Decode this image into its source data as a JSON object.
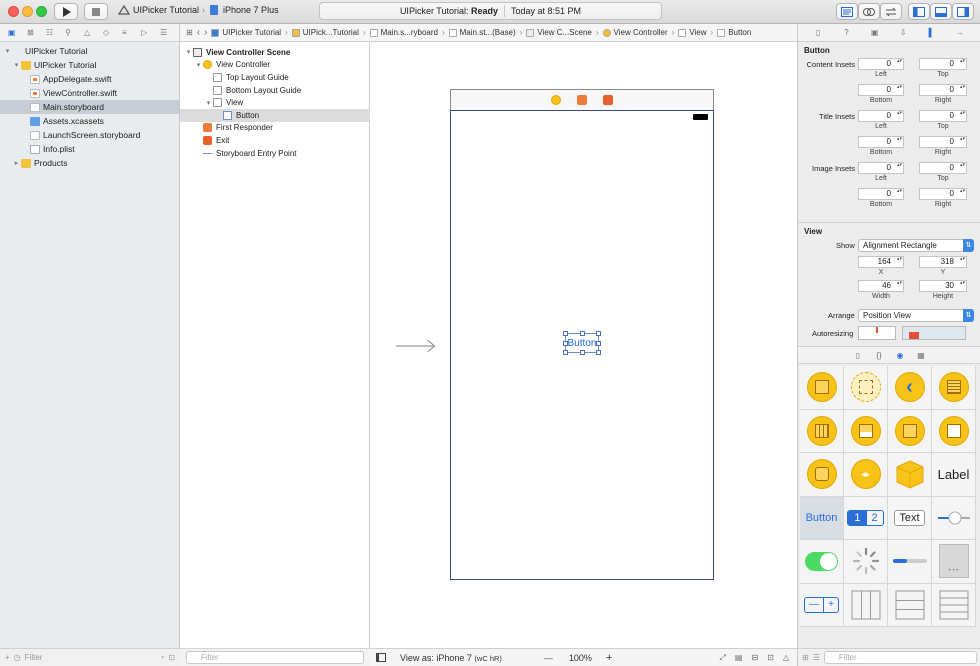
{
  "toolbar": {
    "scheme_project": "UIPicker Tutorial",
    "scheme_device": "iPhone 7 Plus",
    "activity_project": "UIPicker Tutorial:",
    "activity_status": "Ready",
    "activity_time": "Today at 8:51 PM"
  },
  "navigator": {
    "items": [
      {
        "label": "UIPicker Tutorial",
        "type": "project",
        "indent": 0,
        "disclosure": "▾"
      },
      {
        "label": "UIPicker Tutorial",
        "type": "folder",
        "indent": 1,
        "disclosure": "▾"
      },
      {
        "label": "AppDelegate.swift",
        "type": "swift",
        "indent": 2,
        "disclosure": ""
      },
      {
        "label": "ViewController.swift",
        "type": "swift",
        "indent": 2,
        "disclosure": ""
      },
      {
        "label": "Main.storyboard",
        "type": "sb",
        "indent": 2,
        "disclosure": "",
        "selected": true
      },
      {
        "label": "Assets.xcassets",
        "type": "xca",
        "indent": 2,
        "disclosure": ""
      },
      {
        "label": "LaunchScreen.storyboard",
        "type": "sb",
        "indent": 2,
        "disclosure": ""
      },
      {
        "label": "Info.plist",
        "type": "plist",
        "indent": 2,
        "disclosure": ""
      },
      {
        "label": "Products",
        "type": "folder",
        "indent": 1,
        "disclosure": "▸"
      }
    ],
    "filter_placeholder": "Filter"
  },
  "jumpbar": {
    "crumbs": [
      "UIPicker Tutorial",
      "UIPick...Tutorial",
      "Main.s...ryboard",
      "Main.st...(Base)",
      "View C...Scene",
      "View Controller",
      "View",
      "Button"
    ]
  },
  "outline": {
    "items": [
      {
        "label": "View Controller Scene",
        "indent": 0,
        "disclosure": "▾",
        "bold": true,
        "icon": "scene"
      },
      {
        "label": "View Controller",
        "indent": 1,
        "disclosure": "▾",
        "icon": "vc"
      },
      {
        "label": "Top Layout Guide",
        "indent": 2,
        "disclosure": "",
        "icon": "guide"
      },
      {
        "label": "Bottom Layout Guide",
        "indent": 2,
        "disclosure": "",
        "icon": "guide"
      },
      {
        "label": "View",
        "indent": 2,
        "disclosure": "▾",
        "icon": "view"
      },
      {
        "label": "Button",
        "indent": 3,
        "disclosure": "",
        "icon": "button",
        "selected": true
      },
      {
        "label": "First Responder",
        "indent": 1,
        "disclosure": "",
        "icon": "responder"
      },
      {
        "label": "Exit",
        "indent": 1,
        "disclosure": "",
        "icon": "exit"
      },
      {
        "label": "Storyboard Entry Point",
        "indent": 1,
        "disclosure": "",
        "icon": "entry"
      }
    ],
    "filter_placeholder": "Filter"
  },
  "canvas": {
    "button_title": "Button"
  },
  "status": {
    "view_as": "View as: iPhone 7",
    "view_as_suffix": "(wC hR)",
    "zoom_minus": "—",
    "zoom": "100%",
    "zoom_plus": "+"
  },
  "inspector": {
    "button_section": "Button",
    "content_insets_label": "Content Insets",
    "title_insets_label": "Title Insets",
    "image_insets_label": "Image Insets",
    "left": "Left",
    "top": "Top",
    "bottom": "Bottom",
    "right": "Right",
    "zero": "0",
    "view_section": "View",
    "show_label": "Show",
    "show_value": "Alignment Rectangle",
    "x_value": "164",
    "y_value": "318",
    "x_label": "X",
    "y_label": "Y",
    "width_value": "46",
    "height_value": "30",
    "width_label": "Width",
    "height_label": "Height",
    "arrange_label": "Arrange",
    "arrange_value": "Position View",
    "autoresizing_label": "Autoresizing",
    "filter_placeholder": "Filter"
  },
  "library": {
    "label_text": "Label",
    "button_text": "Button",
    "seg_1": "1",
    "seg_2": "2",
    "text_field": "Text",
    "stepper_minus": "—",
    "stepper_plus": "+"
  }
}
